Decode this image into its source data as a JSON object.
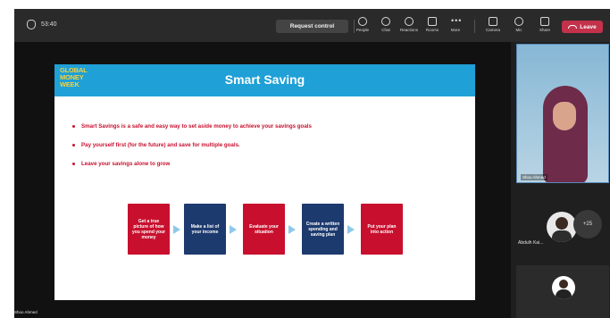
{
  "app": {
    "timer": "53:40",
    "request_control_label": "Request control",
    "toolbar": [
      {
        "label": "People",
        "icon": "people-icon"
      },
      {
        "label": "Chat",
        "icon": "chat-icon"
      },
      {
        "label": "Reactions",
        "icon": "reactions-icon"
      },
      {
        "label": "Rooms",
        "icon": "rooms-icon"
      },
      {
        "label": "More",
        "icon": "more-icon"
      },
      {
        "label": "Camera",
        "icon": "camera-icon"
      },
      {
        "label": "Mic",
        "icon": "mic-icon"
      },
      {
        "label": "Share",
        "icon": "share-icon"
      }
    ],
    "leave_label": "Leave",
    "colors": {
      "leave": "#c4314b",
      "slide_header": "#1fa0d6",
      "step_red": "#c8102e",
      "step_navy": "#1d3a6e"
    }
  },
  "slide": {
    "logo_lines": [
      "GLOBAL",
      "MONEY",
      "WEEK"
    ],
    "title": "Smart Saving",
    "bullets": [
      "Smart Savings is a safe and easy way to set aside money to achieve your savings goals",
      "Pay yourself first (for the future) and save for multiple goals.",
      "Leave your savings alone to grow"
    ],
    "steps": [
      {
        "text": "Get a true picture of how you spend your money",
        "color": "red"
      },
      {
        "text": "Make a list of your income",
        "color": "navy"
      },
      {
        "text": "Evaluate your situation",
        "color": "red"
      },
      {
        "text": "Create a written spending and saving plan",
        "color": "navy"
      },
      {
        "text": "Put your plan into action",
        "color": "red"
      }
    ]
  },
  "presenter_label": "Shoo Ahmed",
  "participants": {
    "main_name": "Shoo Ahmed",
    "second_name": "Abdulh Kai...",
    "overflow_count": "+25"
  }
}
